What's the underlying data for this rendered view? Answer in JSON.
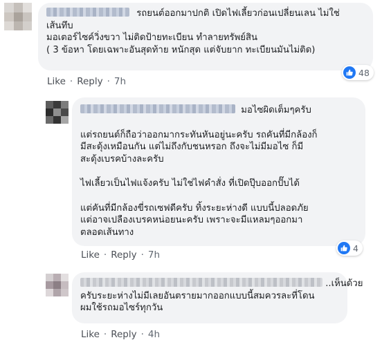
{
  "comments": [
    {
      "text_lines": [
        "รถยนต์ออกมาปกติ เปิดไฟเลี้ยวก่อนเปลี่ยนเลน ไม่ใช่",
        "เส้นทึบ",
        "มอเตอร์ไซค์วิ่งขวา ไม่ติดป้ายทะเบียน ทำลายทรัพย์สิน",
        "( 3 ข้อหา โดยเฉพาะอันสุดท้าย หนักสุด แต่จับยาก ทะเบียนมันไม่ติด)"
      ],
      "actions": {
        "like": "Like",
        "reply": "Reply",
        "time": "7h"
      },
      "reaction_count": "48"
    },
    {
      "header_text": "มอไซผิดเต็มๆครับ",
      "paragraphs": [
        [
          "แต่รถยนต์ก็ถือว่าออกมากระทันหันอยู่นะครับ รถคันที่มีกล้องก็",
          "มีสะดุ้งเหมือนกัน แต่ไม่ถึงกับชนหรอก ถึงจะไม่มีมอไซ ก็มี",
          "สะดุ้งเบรคบ้างละครับ"
        ],
        [
          "ไฟเลี้ยวเป็นไฟแจ้งครับ ไม่ใช่ไฟคำสั่ง ที่เปิดปุ๊บออกปั๊บได้"
        ],
        [
          "แต่คันที่มีกล้องขี่รถเซฟดีครับ ทิ้งระยะห่างดี แบบนี้ปลอดภัย",
          "แต่อาจเปลืองเบรคหน่อยนะครับ เพราะจะมีแหลมๆออกมา",
          "ตลอดเส้นทาง"
        ]
      ],
      "actions": {
        "like": "Like",
        "reply": "Reply",
        "time": "7h"
      },
      "reaction_count": "4"
    },
    {
      "text_lines": [
        "..เห็นด้วย",
        "ครับระยะห่างไม่มีเลยอันตรายมากออกแบบนี้สมควรละที่โดน",
        "ผมใช้รถมอไซร์ทุกวัน"
      ],
      "actions": {
        "like": "Like",
        "reply": "Reply",
        "time": "4h"
      }
    }
  ],
  "colors": {
    "bubble": "#f2f3f5",
    "action_text": "#606770",
    "like_blue": "#2078f4",
    "text": "#1c1e21"
  },
  "icons": {
    "reaction": "thumbs-up-icon"
  }
}
